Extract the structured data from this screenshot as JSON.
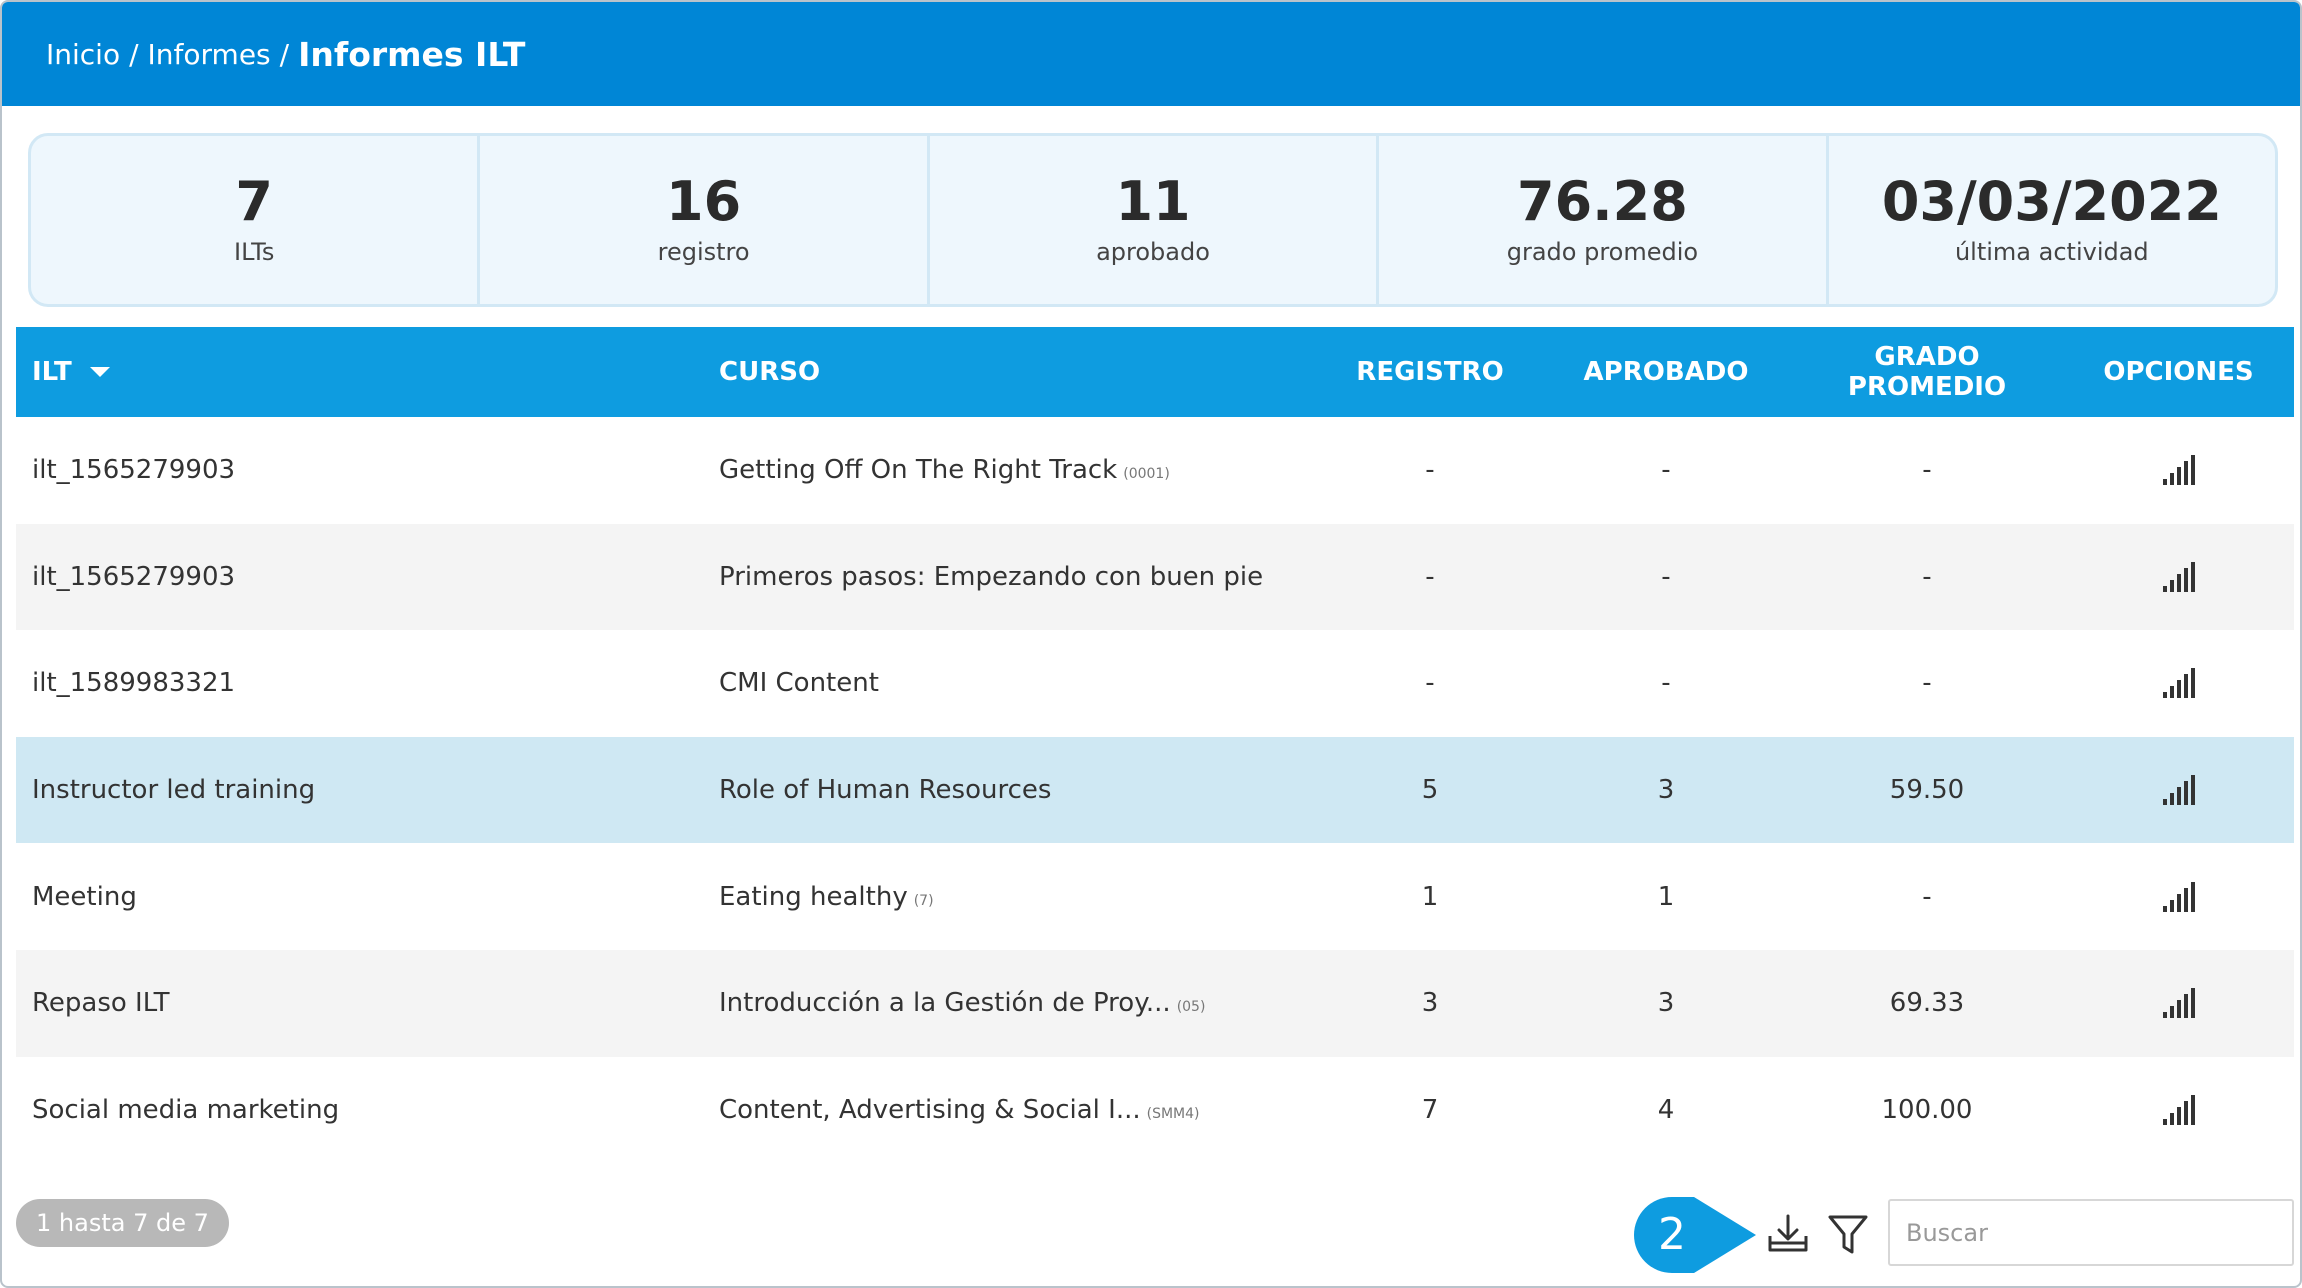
{
  "breadcrumb": {
    "home": "Inicio",
    "sep": "/",
    "reports": "Informes",
    "current": "Informes ILT"
  },
  "stats": [
    {
      "value": "7",
      "label": "ILTs"
    },
    {
      "value": "16",
      "label": "registro"
    },
    {
      "value": "11",
      "label": "aprobado"
    },
    {
      "value": "76.28",
      "label": "grado promedio"
    },
    {
      "value": "03/03/2022",
      "label": "última actividad"
    }
  ],
  "table": {
    "headers": {
      "ilt": "ILT",
      "curso": "CURSO",
      "registro": "REGISTRO",
      "aprobado": "APROBADO",
      "grado": "GRADO PROMEDIO",
      "opciones": "OPCIONES"
    },
    "rows": [
      {
        "ilt": "ilt_1565279903",
        "curso": "Getting Off On The Right Track",
        "code": "(0001)",
        "registro": "-",
        "aprobado": "-",
        "grado": "-"
      },
      {
        "ilt": "ilt_1565279903",
        "curso": "Primeros pasos: Empezando con buen pie",
        "code": "",
        "registro": "-",
        "aprobado": "-",
        "grado": "-"
      },
      {
        "ilt": "ilt_1589983321",
        "curso": "CMI Content",
        "code": "",
        "registro": "-",
        "aprobado": "-",
        "grado": "-"
      },
      {
        "ilt": "Instructor led training",
        "curso": "Role of Human Resources",
        "code": "",
        "registro": "5",
        "aprobado": "3",
        "grado": "59.50"
      },
      {
        "ilt": "Meeting",
        "curso": "Eating healthy",
        "code": "(7)",
        "registro": "1",
        "aprobado": "1",
        "grado": "-"
      },
      {
        "ilt": "Repaso ILT",
        "curso": "Introducción a la Gestión de Proy...",
        "code": "(05)",
        "registro": "3",
        "aprobado": "3",
        "grado": "69.33"
      },
      {
        "ilt": "Social media marketing",
        "curso": "Content, Advertising & Social I...",
        "code": "(SMM4)",
        "registro": "7",
        "aprobado": "4",
        "grado": "100.00"
      }
    ]
  },
  "footer": {
    "count": "1 hasta 7 de 7",
    "step_badge": "2",
    "search_placeholder": "Buscar"
  },
  "icons": {
    "options": "signal-bars-icon",
    "export": "download-tray-icon",
    "filter": "funnel-icon",
    "sort": "caret-down-icon"
  },
  "colors": {
    "header": "#0086d6",
    "table_header": "#0e9ce0",
    "highlight_row": "#cfe8f3",
    "badge": "#0e9ce0"
  }
}
